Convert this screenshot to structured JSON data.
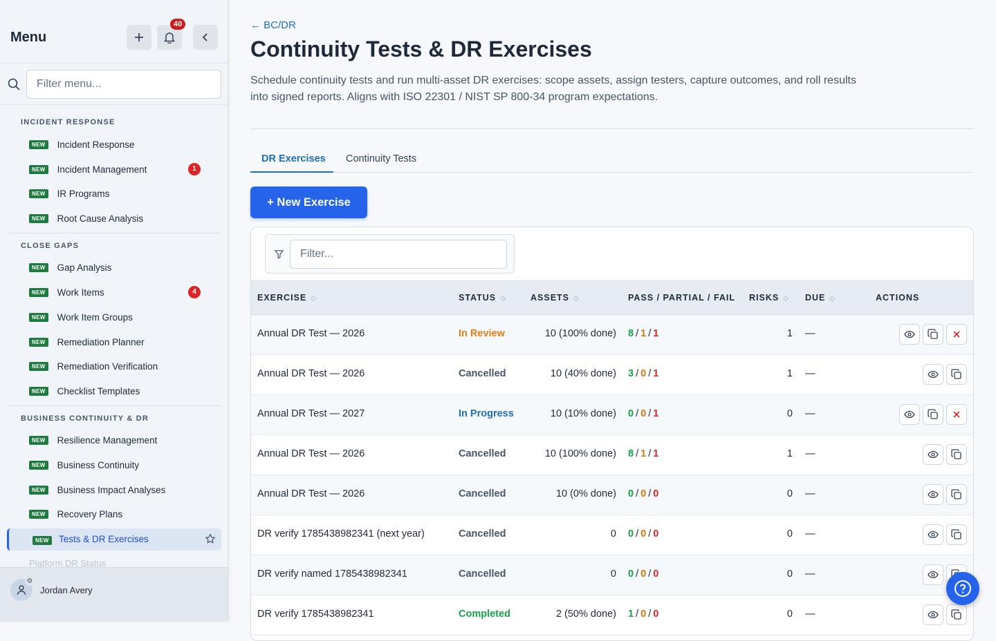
{
  "sidebar": {
    "title": "Menu",
    "notifications_count": "40",
    "filter_placeholder": "Filter menu...",
    "new_tag": "NEW",
    "sections": [
      {
        "label": "INCIDENT RESPONSE",
        "items": [
          {
            "label": "Incident Response"
          },
          {
            "label": "Incident Management",
            "count": "1"
          },
          {
            "label": "IR Programs"
          },
          {
            "label": "Root Cause Analysis"
          }
        ]
      },
      {
        "label": "CLOSE GAPS",
        "items": [
          {
            "label": "Gap Analysis"
          },
          {
            "label": "Work Items",
            "count": "4"
          },
          {
            "label": "Work Item Groups"
          },
          {
            "label": "Remediation Planner"
          },
          {
            "label": "Remediation Verification"
          },
          {
            "label": "Checklist Templates"
          }
        ]
      },
      {
        "label": "BUSINESS CONTINUITY & DR",
        "items": [
          {
            "label": "Resilience Management"
          },
          {
            "label": "Business Continuity"
          },
          {
            "label": "Business Impact Analyses"
          },
          {
            "label": "Recovery Plans"
          },
          {
            "label": "Tests & DR Exercises",
            "active": true
          },
          {
            "label": "Platform DR Status"
          }
        ]
      }
    ],
    "user_name": "Jordan Avery"
  },
  "header": {
    "breadcrumb": "← BC/DR",
    "title": "Continuity Tests & DR Exercises",
    "description": "Schedule continuity tests and run multi-asset DR exercises: scope assets, assign testers, capture outcomes, and roll results into signed reports. Aligns with ISO 22301 / NIST SP 800-34 program expectations."
  },
  "tabs": [
    {
      "label": "DR Exercises",
      "active": true
    },
    {
      "label": "Continuity Tests"
    }
  ],
  "new_button": "+ New Exercise",
  "table": {
    "filter_placeholder": "Filter...",
    "columns": [
      "EXERCISE",
      "STATUS",
      "ASSETS",
      "PASS / PARTIAL / FAIL",
      "RISKS",
      "DUE",
      "ACTIONS"
    ],
    "rows": [
      {
        "exercise": "Annual DR Test — 2026",
        "status": "In Review",
        "status_color": "#ea7a12",
        "assets": "10 (100% done)",
        "pass": "8",
        "partial": "1",
        "fail": "1",
        "risks": "1",
        "due": "—",
        "cancel": true
      },
      {
        "exercise": "Annual DR Test — 2026",
        "status": "Cancelled",
        "status_color": "#475569",
        "assets": "10 (40% done)",
        "pass": "3",
        "partial": "0",
        "fail": "1",
        "risks": "1",
        "due": "—",
        "cancel": false
      },
      {
        "exercise": "Annual DR Test — 2027",
        "status": "In Progress",
        "status_color": "#1d6fb8",
        "assets": "10 (10% done)",
        "pass": "0",
        "partial": "0",
        "fail": "1",
        "risks": "0",
        "due": "—",
        "cancel": true
      },
      {
        "exercise": "Annual DR Test — 2026",
        "status": "Cancelled",
        "status_color": "#475569",
        "assets": "10 (100% done)",
        "pass": "8",
        "partial": "1",
        "fail": "1",
        "risks": "1",
        "due": "—",
        "cancel": false
      },
      {
        "exercise": "Annual DR Test — 2026",
        "status": "Cancelled",
        "status_color": "#475569",
        "assets": "10 (0% done)",
        "pass": "0",
        "partial": "0",
        "fail": "0",
        "risks": "0",
        "due": "—",
        "cancel": false
      },
      {
        "exercise": "DR verify 1785438982341 (next year)",
        "status": "Cancelled",
        "status_color": "#475569",
        "assets": "0",
        "pass": "0",
        "partial": "0",
        "fail": "0",
        "risks": "0",
        "due": "—",
        "cancel": false
      },
      {
        "exercise": "DR verify named 1785438982341",
        "status": "Cancelled",
        "status_color": "#475569",
        "assets": "0",
        "pass": "0",
        "partial": "0",
        "fail": "0",
        "risks": "0",
        "due": "—",
        "cancel": false
      },
      {
        "exercise": "DR verify 1785438982341",
        "status": "Completed",
        "status_color": "#16a34a",
        "assets": "2 (50% done)",
        "pass": "1",
        "partial": "0",
        "fail": "0",
        "risks": "0",
        "due": "—",
        "cancel": false
      }
    ]
  },
  "colors": {
    "accent": "#2563eb",
    "link": "#1d6fb8",
    "new_badge": "#1f7a3f",
    "count_badge": "#dc2626"
  }
}
